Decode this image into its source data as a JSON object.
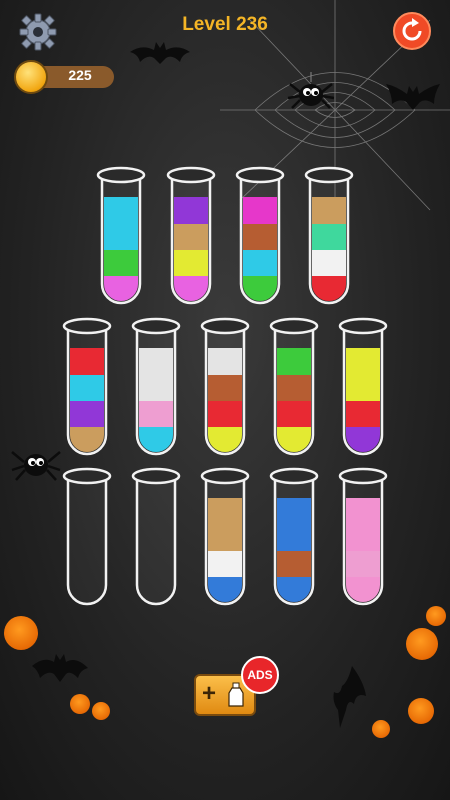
{
  "header": {
    "level_label": "Level 236",
    "coins": "225",
    "settings_icon": "gear-icon",
    "restart_icon": "restart-icon"
  },
  "footer": {
    "add_tube_icon": "plus-bottle-icon",
    "ads_badge": "ADS"
  },
  "colors": {
    "cyan": "#27c8e6",
    "green": "#36c935",
    "pink": "#e85ce0",
    "purple": "#8d2fd6",
    "tan": "#c99a58",
    "yellow": "#e2ea2a",
    "magenta": "#e52fc8",
    "brown": "#b4572a",
    "mint": "#38d79a",
    "white": "#f2f2f2",
    "red": "#e8212b",
    "silver": "#e3e3e3",
    "lightpink": "#ee9bd0",
    "blue": "#2b76d8",
    "rose": "#f28ecf"
  },
  "tubes": [
    {
      "id": "tube-1",
      "layers": [
        "pink",
        "green",
        "cyan",
        "cyan"
      ]
    },
    {
      "id": "tube-2",
      "layers": [
        "pink",
        "yellow",
        "tan",
        "purple"
      ]
    },
    {
      "id": "tube-3",
      "layers": [
        "green",
        "cyan",
        "brown",
        "magenta"
      ]
    },
    {
      "id": "tube-4",
      "layers": [
        "red",
        "white",
        "mint",
        "tan"
      ]
    },
    {
      "id": "tube-5",
      "layers": [
        "tan",
        "purple",
        "cyan",
        "red"
      ]
    },
    {
      "id": "tube-6",
      "layers": [
        "cyan",
        "lightpink",
        "silver",
        "silver"
      ]
    },
    {
      "id": "tube-7",
      "layers": [
        "yellow",
        "red",
        "brown",
        "silver"
      ]
    },
    {
      "id": "tube-8",
      "layers": [
        "yellow",
        "red",
        "brown",
        "green"
      ]
    },
    {
      "id": "tube-9",
      "layers": [
        "purple",
        "red",
        "yellow",
        "yellow"
      ]
    },
    {
      "id": "tube-10",
      "layers": []
    },
    {
      "id": "tube-11",
      "layers": []
    },
    {
      "id": "tube-12",
      "layers": [
        "blue",
        "white",
        "tan",
        "tan"
      ]
    },
    {
      "id": "tube-13",
      "layers": [
        "blue",
        "brown",
        "blue",
        "blue"
      ]
    },
    {
      "id": "tube-14",
      "layers": [
        "rose",
        "lightpink",
        "rose",
        "rose"
      ]
    }
  ]
}
